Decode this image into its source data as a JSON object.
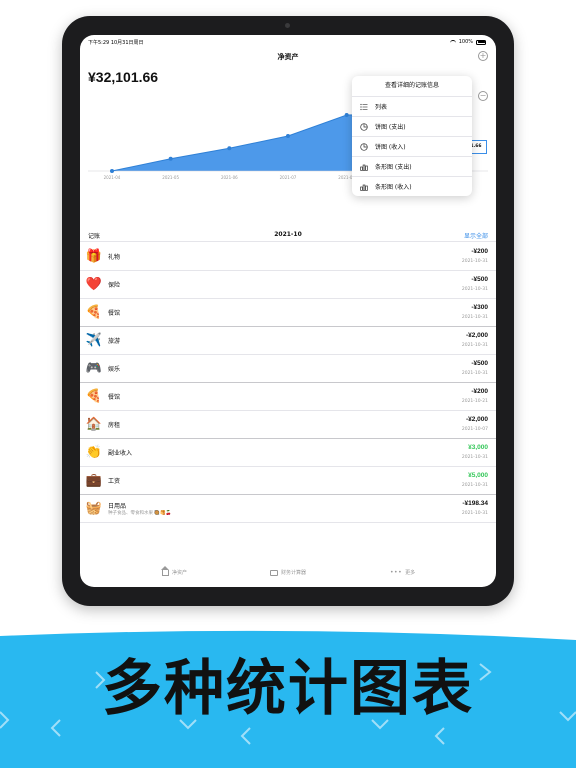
{
  "status_bar": {
    "time": "下午5:29  10月31日周日",
    "battery": "100%"
  },
  "nav": {
    "title": "净资产"
  },
  "summary": {
    "total": "¥32,101.66"
  },
  "chart_data": {
    "type": "area",
    "categories": [
      "2021-04",
      "2021-05",
      "2021-06",
      "2021-07",
      "2021-08",
      "2021-09",
      "2021-10"
    ],
    "values": [
      0,
      7000,
      13000,
      20000,
      32000,
      32500,
      32101.66
    ],
    "ylim": [
      0,
      40000
    ],
    "grid": false,
    "tooltip_value": "1.66",
    "color": "#3a8ee8"
  },
  "menu": {
    "title": "查看详细的记账信息",
    "items": [
      {
        "label": "列表",
        "icon": "list-icon"
      },
      {
        "label": "饼图 (支出)",
        "icon": "pie-chart-icon"
      },
      {
        "label": "饼图 (收入)",
        "icon": "pie-chart-icon"
      },
      {
        "label": "条形图 (支出)",
        "icon": "bar-chart-icon"
      },
      {
        "label": "条形图 (收入)",
        "icon": "bar-chart-icon"
      }
    ]
  },
  "section": {
    "title": "记账",
    "month": "2021-10",
    "show_all": "显示全部"
  },
  "records": [
    {
      "name": "礼物",
      "amount": "-¥200",
      "date": "2021-10-31",
      "icon": "🎁",
      "type": "expense"
    },
    {
      "name": "保险",
      "amount": "-¥500",
      "date": "2021-10-31",
      "icon": "❤️",
      "type": "expense"
    },
    {
      "name": "餐馆",
      "amount": "-¥300",
      "date": "2021-10-31",
      "icon": "🍕",
      "type": "expense"
    },
    {
      "name": "旅游",
      "amount": "-¥2,000",
      "date": "2021-10-31",
      "icon": "✈️",
      "type": "expense"
    },
    {
      "name": "娱乐",
      "amount": "-¥500",
      "date": "2021-10-31",
      "icon": "🎮",
      "type": "expense"
    },
    {
      "name": "餐馆",
      "amount": "-¥200",
      "date": "2021-10-21",
      "icon": "🍕",
      "type": "expense"
    },
    {
      "name": "房租",
      "amount": "-¥2,000",
      "date": "2021-10-07",
      "icon": "🏠",
      "type": "expense"
    },
    {
      "name": "副业收入",
      "amount": "¥3,000",
      "date": "2021-10-31",
      "icon": "👏",
      "type": "income"
    },
    {
      "name": "工资",
      "amount": "¥5,000",
      "date": "2021-10-31",
      "icon": "💼",
      "type": "income"
    },
    {
      "name": "日用品",
      "note": "种子食品、零食和水果 🥘🥞🍒",
      "amount": "-¥198.34",
      "date": "2021-10-31",
      "icon": "🧺",
      "type": "expense"
    }
  ],
  "tabs": [
    {
      "label": "净资产",
      "icon": "home-icon"
    },
    {
      "label": "财务计算器",
      "icon": "briefcase-icon"
    },
    {
      "label": "更多",
      "icon": "more-icon"
    }
  ],
  "slogan": "多种统计图表"
}
